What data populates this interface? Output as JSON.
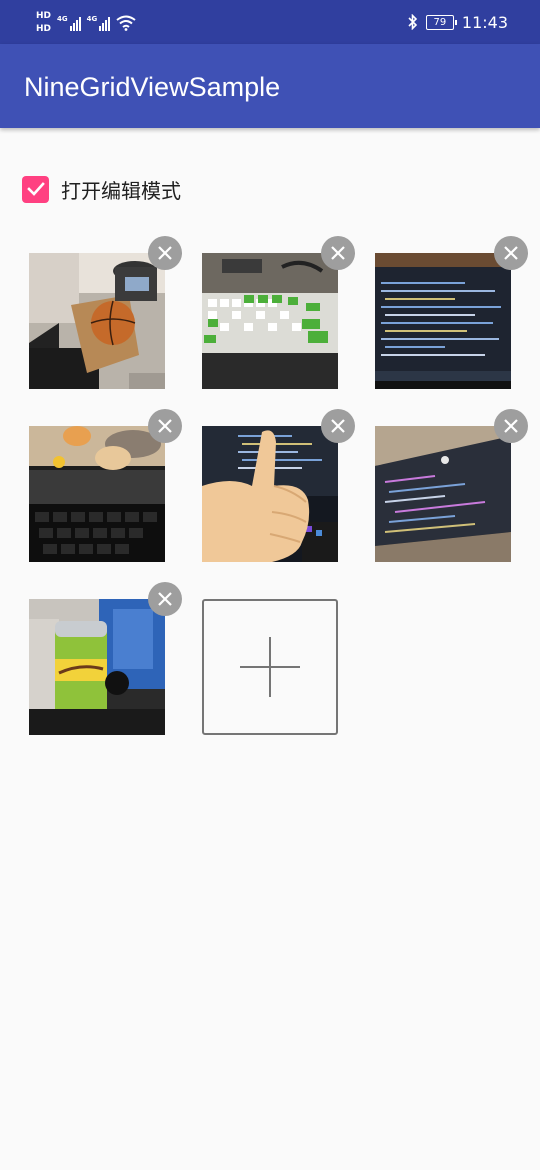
{
  "status_bar": {
    "hd1": "HD",
    "hd2": "HD",
    "net1": "4G",
    "net2": "4G",
    "battery": "79",
    "time": "11:43",
    "icons": [
      "hd-icon",
      "signal-icon",
      "wifi-icon",
      "bluetooth-icon",
      "battery-icon"
    ]
  },
  "app_bar": {
    "title": "NineGridViewSample"
  },
  "edit_mode": {
    "label": "打开编辑模式",
    "checked": true
  },
  "grid": {
    "photos": [
      {
        "name": "photo-basketball-bin",
        "icon": "close-icon"
      },
      {
        "name": "photo-green-keyboard",
        "icon": "close-icon"
      },
      {
        "name": "photo-monitor-code",
        "icon": "close-icon"
      },
      {
        "name": "photo-desk-keyboard-toys",
        "icon": "close-icon"
      },
      {
        "name": "photo-thumbs-up",
        "icon": "close-icon"
      },
      {
        "name": "photo-monitor-code-angle",
        "icon": "close-icon"
      },
      {
        "name": "photo-schweppes-can",
        "icon": "close-icon"
      }
    ],
    "add_icon": "plus-icon"
  },
  "colors": {
    "status_bar": "#303f9f",
    "app_bar": "#3f51b5",
    "checkbox": "#ff4081",
    "delete_button": "#9e9e9e",
    "background": "#fafafa"
  }
}
